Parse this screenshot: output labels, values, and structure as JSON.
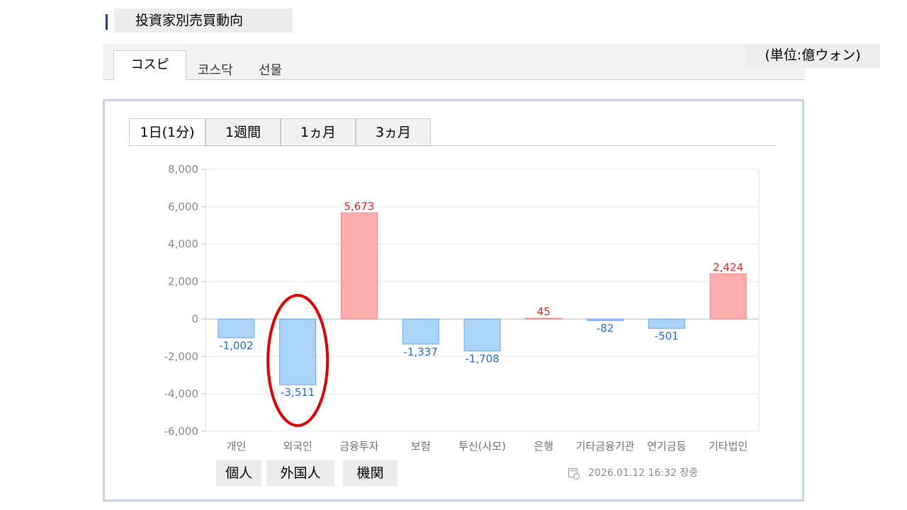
{
  "section": {
    "title": "投資家別売買動向"
  },
  "unit_label": "(単位:億ウォン)",
  "market_tabs": [
    "コスピ",
    "코스닥",
    "선물"
  ],
  "period_tabs": [
    "1日(1分)",
    "1週間",
    "1ヵ月",
    "3ヵ月"
  ],
  "investor_labels": [
    "個人",
    "外国人",
    "機関"
  ],
  "timestamp": "2026.01.12 16:32 장중",
  "colors": {
    "positive_fill": "#ffacac",
    "positive_text": "#e02424",
    "negative_fill": "#aad4fb",
    "negative_text": "#1f6fd6",
    "highlight": "#e00000"
  },
  "chart_data": {
    "type": "bar",
    "categories": [
      "개인",
      "외국인",
      "금융투자",
      "보험",
      "투신(사모)",
      "은행",
      "기타금융기관",
      "연기금등",
      "기타법인"
    ],
    "values": [
      -1002,
      -3511,
      5673,
      -1337,
      -1708,
      45,
      -82,
      -501,
      2424
    ],
    "value_labels": [
      "-1,002",
      "-3,511",
      "5,673",
      "-1,337",
      "-1,708",
      "45",
      "-82",
      "-501",
      "2,424"
    ],
    "ylim": [
      -6000,
      8000
    ],
    "yticks": [
      "8,000",
      "6,000",
      "4,000",
      "2,000",
      "0",
      "-2,000",
      "-4,000",
      "-6,000"
    ],
    "ytick_values": [
      8000,
      6000,
      4000,
      2000,
      0,
      -2000,
      -4000,
      -6000
    ],
    "highlighted_category": "외국인",
    "grid": true
  }
}
